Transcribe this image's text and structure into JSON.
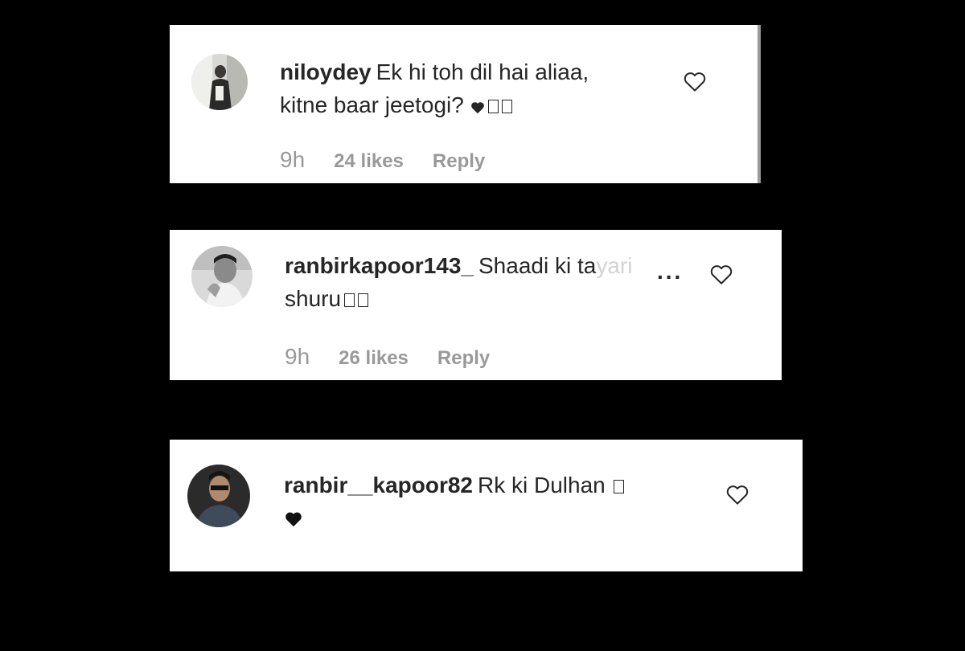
{
  "comments": [
    {
      "username": "niloydey",
      "text_line1": "Ek hi toh dil hai aliaa,",
      "text_line2": "kitne baar jeetogi?",
      "time": "9h",
      "likes": "24 likes",
      "reply_label": "Reply",
      "trailing_icons": [
        "heart-icon",
        "box-glyph",
        "box-glyph"
      ],
      "like_icon": "heart-outline-icon"
    },
    {
      "username": "ranbirkapoor143_",
      "text_line1": "Shaadi ki ta",
      "text_faded": "yari",
      "more_label": "...",
      "text_line2": "shuru",
      "time": "9h",
      "likes": "26 likes",
      "reply_label": "Reply",
      "trailing_icons": [
        "box-glyph",
        "box-glyph"
      ],
      "like_icon": "heart-outline-icon"
    },
    {
      "username": "ranbir__kapoor82",
      "text_line1": "Rk ki Dulhan",
      "trailing_icons": [
        "box-glyph",
        "heart-icon"
      ],
      "like_icon": "heart-outline-icon"
    }
  ],
  "colors": {
    "background": "#000000",
    "card": "#ffffff",
    "text": "#262626",
    "meta": "#999999"
  }
}
